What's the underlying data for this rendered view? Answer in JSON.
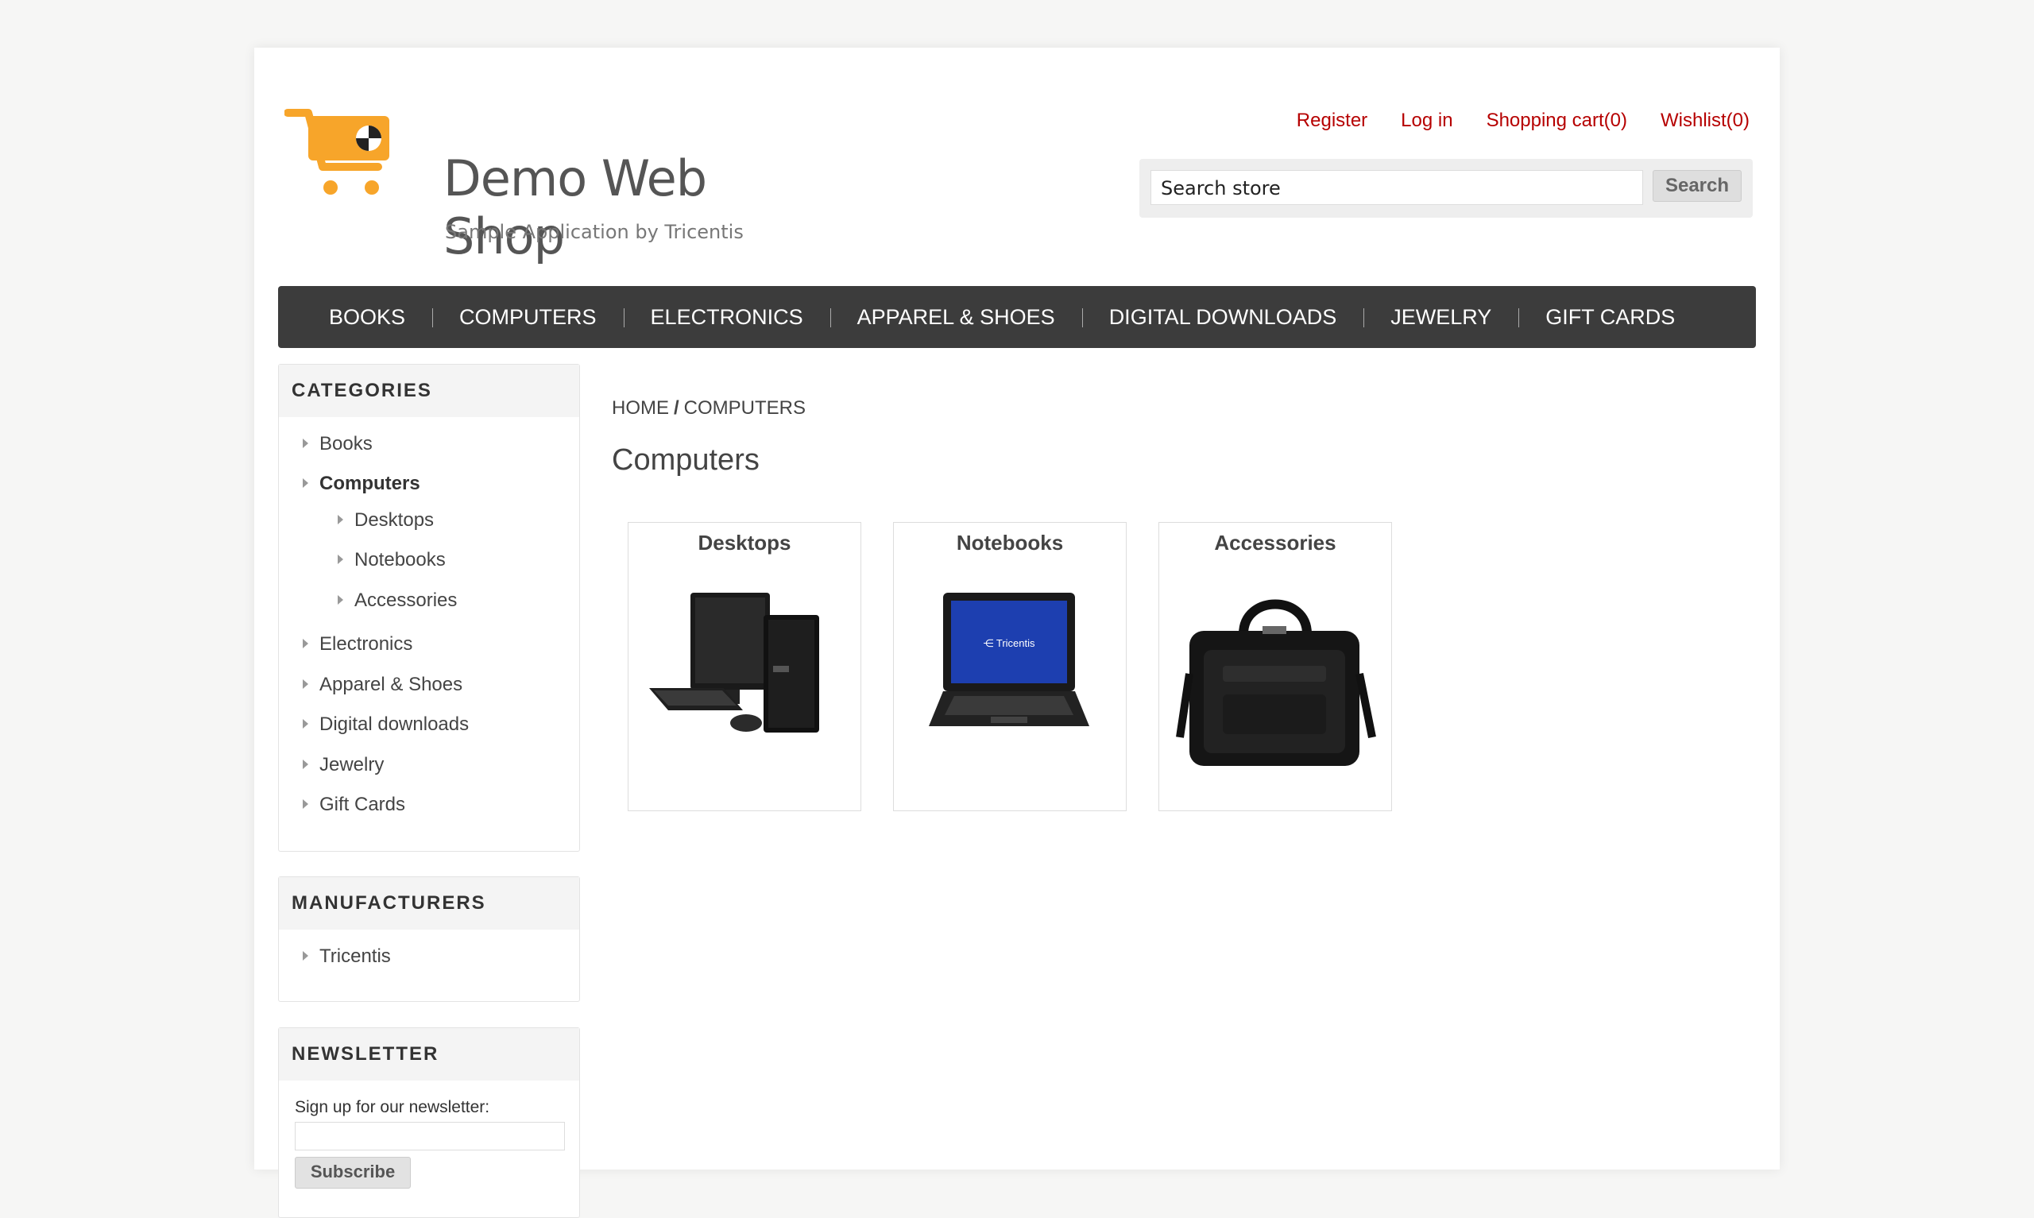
{
  "header": {
    "logo_title": "Demo Web Shop",
    "logo_subtitle": "Sample Application by Tricentis",
    "links": [
      "Register",
      "Log in",
      "Shopping cart(0)",
      "Wishlist(0)"
    ],
    "search_placeholder": "Search store",
    "search_button": "Search"
  },
  "top_menu": [
    "BOOKS",
    "COMPUTERS",
    "ELECTRONICS",
    "APPAREL & SHOES",
    "DIGITAL DOWNLOADS",
    "JEWELRY",
    "GIFT CARDS"
  ],
  "categories": {
    "title": "CATEGORIES",
    "items": [
      "Books",
      "Computers",
      "Desktops",
      "Notebooks",
      "Accessories",
      "Electronics",
      "Apparel & Shoes",
      "Digital downloads",
      "Jewelry",
      "Gift Cards"
    ],
    "active": "Computers"
  },
  "manufacturers": {
    "title": "MANUFACTURERS",
    "items": [
      "Tricentis"
    ]
  },
  "newsletter": {
    "title": "NEWSLETTER",
    "label": "Sign up for our newsletter:",
    "button": "Subscribe"
  },
  "breadcrumb": {
    "home": "HOME",
    "separator": "/",
    "current": "COMPUTERS"
  },
  "page_title": "Computers",
  "sub_categories": [
    {
      "name": "Desktops",
      "image": "desktop-computer-image"
    },
    {
      "name": "Notebooks",
      "image": "laptop-image"
    },
    {
      "name": "Accessories",
      "image": "laptop-bag-image"
    }
  ],
  "colors": {
    "link_red": "#b60000",
    "menu_bg": "#3c3c3c",
    "logo_orange": "#f7a52a"
  }
}
